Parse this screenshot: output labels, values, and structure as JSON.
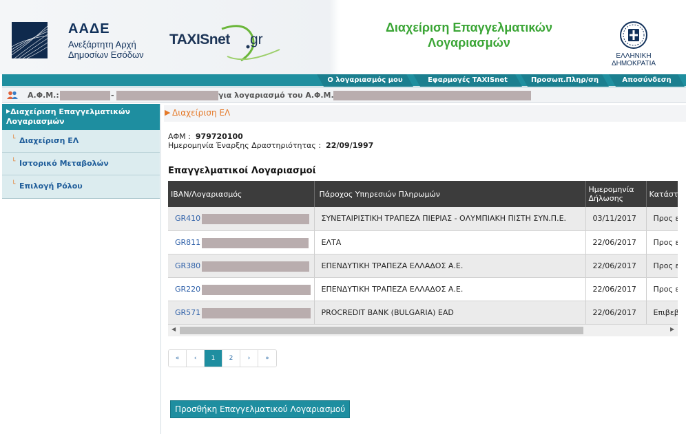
{
  "header": {
    "aade_title": "ΑΑΔΕ",
    "aade_subtitle_line1": "Ανεξάρτητη Αρχή",
    "aade_subtitle_line2": "Δημοσίων Εσόδων",
    "taxisnet_name": "TAXISnet",
    "taxisnet_domain": "gr",
    "app_title_line1": "Διαχείριση Επαγγελματικών",
    "app_title_line2": "Λογαριασμών",
    "gov_label": "ΕΛΛΗΝΙΚΗ ΔΗΜΟΚΡΑΤΙΑ"
  },
  "nav": {
    "tabs": [
      {
        "label": "Ο λογαριασμός μου"
      },
      {
        "label": "Εφαρμογές TAXISnet"
      },
      {
        "label": "Προσωπ.Πληρ/ση"
      },
      {
        "label": "Αποσύνδεση"
      }
    ]
  },
  "userbar": {
    "afm_label": "Α.Φ.Μ.:",
    "separator": "-",
    "for_account_text": "για λογαριασμό του Α.Φ.Μ.:"
  },
  "sidebar": {
    "heading": "Διαχείριση Επαγγελματικών Λογαριασμών",
    "items": [
      {
        "label": "Διαχείριση ΕΛ"
      },
      {
        "label": "Ιστορικό Μεταβολών"
      },
      {
        "label": "Επιλογή Ρόλου"
      }
    ]
  },
  "main": {
    "breadcrumb": "Διαχείριση ΕΛ",
    "afm_label": "ΑΦΜ :",
    "afm_value": "979720100",
    "start_date_label": "Ημερομηνία Έναρξης Δραστηριότητας :",
    "start_date_value": "22/09/1997",
    "section_title": "Επαγγελματικοί Λογαριασμοί",
    "table": {
      "headers": [
        "IBAN/Λογαριασμός",
        "Πάροχος Υπηρεσιών Πληρωμών",
        "Ημερομηνία Δήλωσης",
        "Κατάστ"
      ],
      "rows": [
        {
          "iban": "GR410",
          "provider": "ΣΥΝΕΤΑΙΡΙΣΤΙΚΗ ΤΡΑΠΕΖΑ ΠΙΕΡΙΑΣ - ΟΛΥΜΠΙΑΚΗ ΠΙΣΤΗ ΣΥΝ.Π.Ε.",
          "date": "03/11/2017",
          "status": "Προς ε"
        },
        {
          "iban": "GR811",
          "provider": "ΕΛΤΑ",
          "date": "22/06/2017",
          "status": "Προς ε"
        },
        {
          "iban": "GR380",
          "provider": "ΕΠΕΝΔΥΤΙΚΗ ΤΡΑΠΕΖΑ ΕΛΛΑΔΟΣ Α.Ε.",
          "date": "22/06/2017",
          "status": "Προς ε"
        },
        {
          "iban": "GR220",
          "provider": "ΕΠΕΝΔΥΤΙΚΗ ΤΡΑΠΕΖΑ ΕΛΛΑΔΟΣ Α.Ε.",
          "date": "22/06/2017",
          "status": "Προς ε"
        },
        {
          "iban": "GR571",
          "provider": "PROCREDIT BANK (BULGARIA) EAD",
          "date": "22/06/2017",
          "status": "Επιβεβ"
        }
      ]
    },
    "pagination": {
      "first": "«",
      "prev": "‹",
      "page1": "1",
      "page2": "2",
      "next": "›",
      "last": "»",
      "current_page": 1
    },
    "add_button": "Προσθήκη Επαγγελματικού Λογαριασμού"
  },
  "colors": {
    "teal": "#1e8ea0",
    "accent_orange": "#e57a2a",
    "title_green": "#3aa535",
    "navy": "#10305a"
  }
}
